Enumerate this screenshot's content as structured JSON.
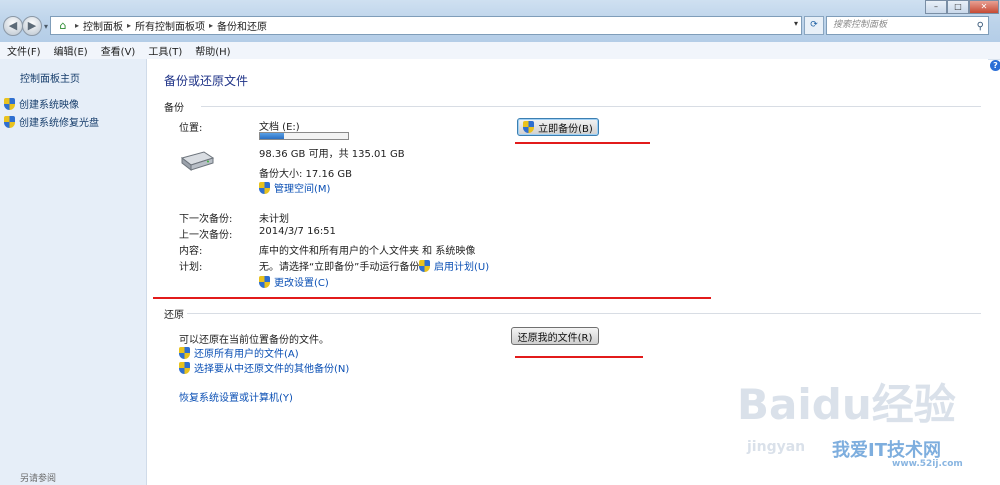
{
  "window": {
    "nav_back": "◀",
    "nav_forward": "▶",
    "breadcrumbs": [
      "控制面板",
      "所有控制面板项",
      "备份和还原"
    ],
    "search_placeholder": "搜索控制面板",
    "icons": {
      "address": "control-panel-icon",
      "search": "search-icon",
      "refresh": "refresh-icon"
    }
  },
  "menu": [
    "文件(F)",
    "编辑(E)",
    "查看(V)",
    "工具(T)",
    "帮助(H)"
  ],
  "sidebar": {
    "home": "控制面板主页",
    "tasks": [
      "创建系统映像",
      "创建系统修复光盘"
    ],
    "see_also": "另请参阅"
  },
  "main": {
    "title": "备份或还原文件",
    "backup": {
      "section": "备份",
      "location_label": "位置:",
      "location_value": "文档 (E:)",
      "disk_used_fraction": 0.27,
      "free_space": "98.36 GB 可用，共 135.01 GB",
      "backup_size": "备份大小: 17.16 GB",
      "manage_space": "管理空间(M)",
      "backup_now": "立即备份(B)",
      "next_backup_label": "下一次备份:",
      "next_backup_value": "未计划",
      "last_backup_label": "上一次备份:",
      "last_backup_value": "2014/3/7 16:51",
      "contents_label": "内容:",
      "contents_value": "库中的文件和所有用户的个人文件夹 和 系统映像",
      "schedule_label": "计划:",
      "schedule_value": "无。请选择“立即备份”手动运行备份。",
      "enable_schedule": "启用计划(U)",
      "change_settings": "更改设置(C)"
    },
    "restore": {
      "section": "还原",
      "description": "可以还原在当前位置备份的文件。",
      "restore_my_files": "还原我的文件(R)",
      "restore_all_users": "还原所有用户的文件(A)",
      "select_other_backup": "选择要从中还原文件的其他备份(N)",
      "recover_system": "恢复系统设置或计算机(Y)"
    }
  },
  "colors": {
    "annotation_red": "#e21b1b",
    "link_blue": "#0a4fb4",
    "title_blue": "#1e3287"
  },
  "watermarks": {
    "baidu": "Baidu经验",
    "site": "我爱IT技术网",
    "domain": "www.52ij.com",
    "jingyan": "jingyan"
  }
}
